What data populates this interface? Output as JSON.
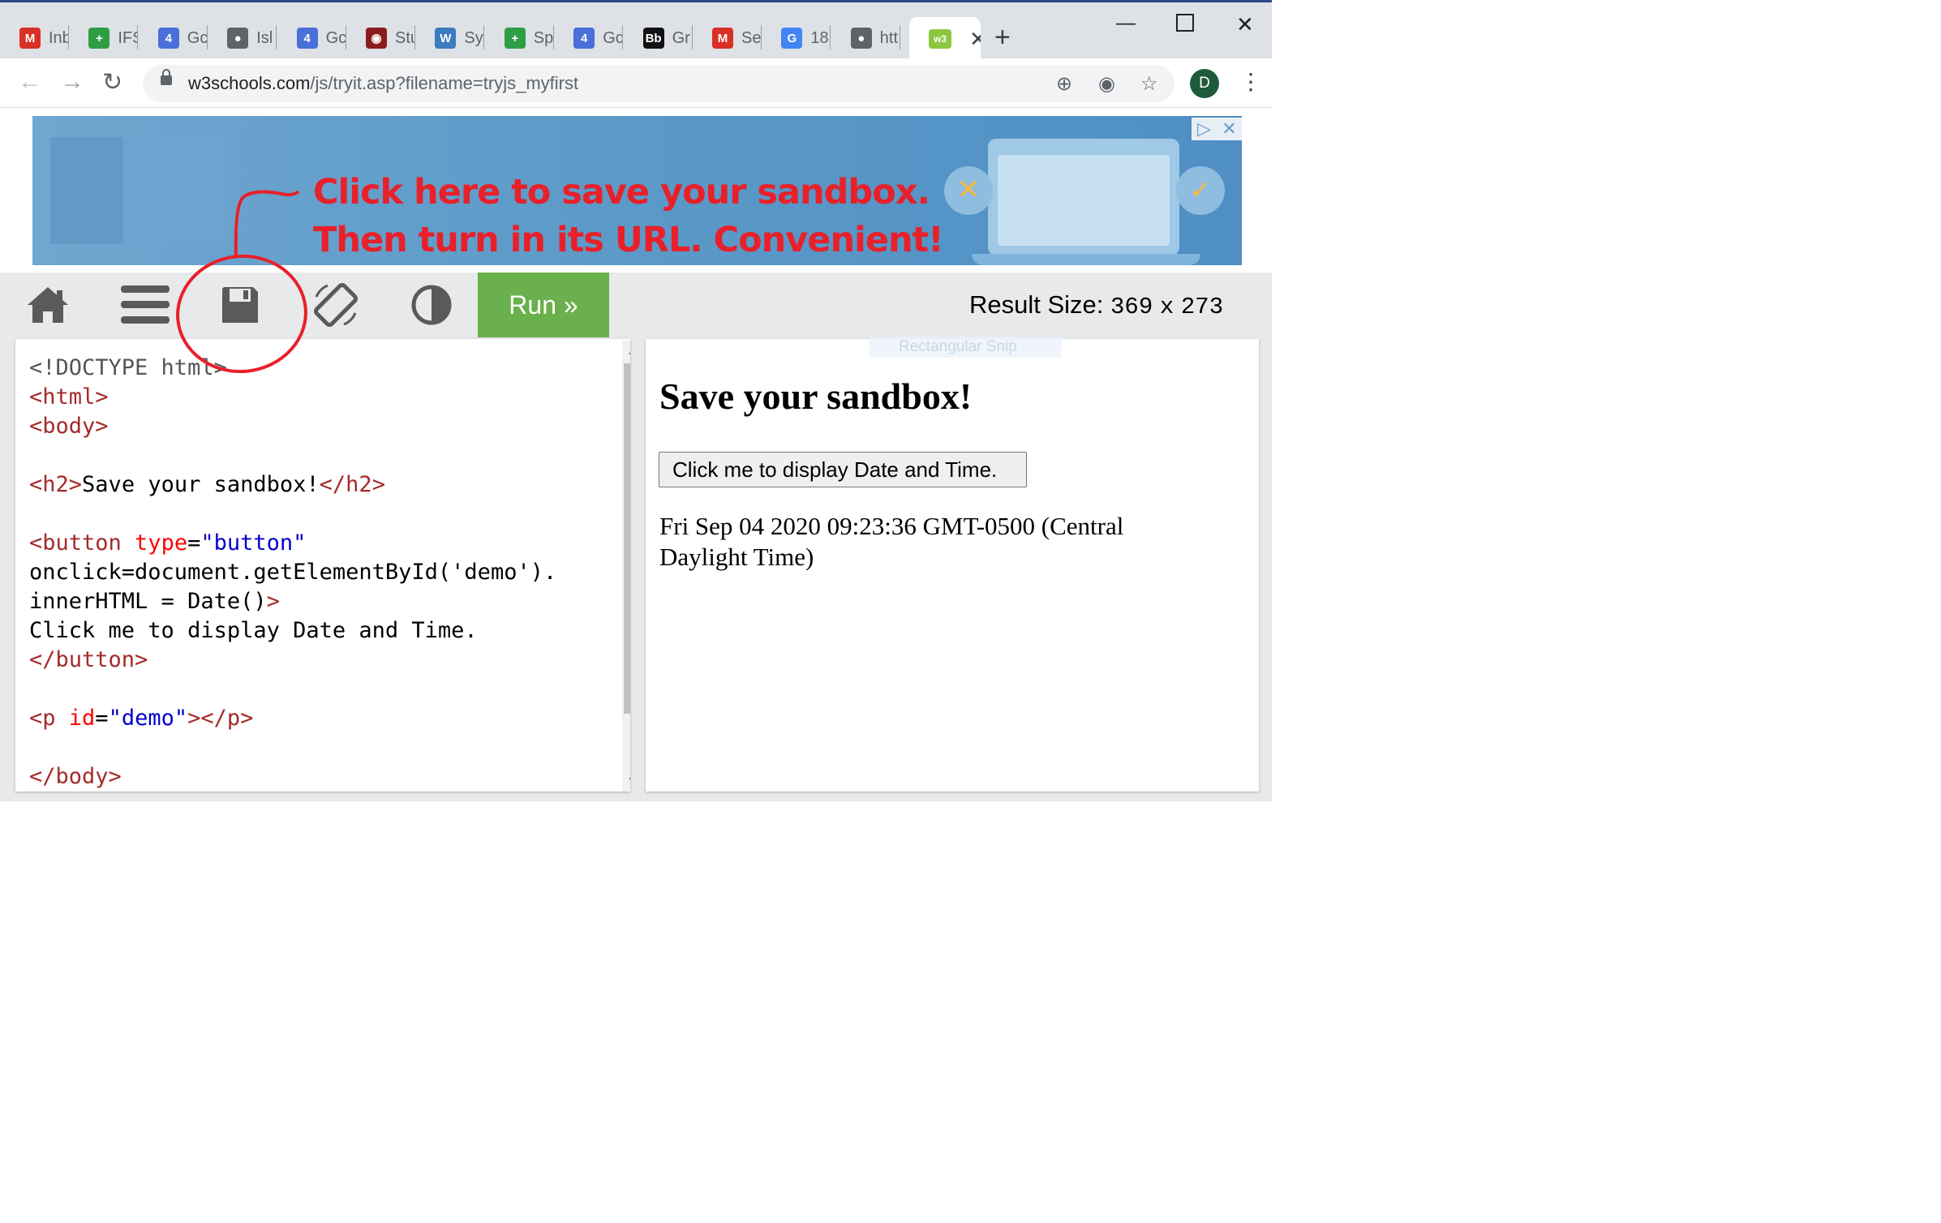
{
  "browser": {
    "tabs": [
      {
        "title": "Inb",
        "icon": "gmail-icon",
        "color": "#d93025",
        "glyph": "M"
      },
      {
        "title": "IFS",
        "icon": "plus-green-icon",
        "color": "#2e9e45",
        "glyph": "+"
      },
      {
        "title": "Gc",
        "icon": "calendar-icon",
        "color": "#4a6fd8",
        "glyph": "4"
      },
      {
        "title": "Isl",
        "icon": "globe-icon",
        "color": "#5f6368",
        "glyph": "●"
      },
      {
        "title": "Gc",
        "icon": "calendar-icon",
        "color": "#4a6fd8",
        "glyph": "4"
      },
      {
        "title": "Stu",
        "icon": "helmet-icon",
        "color": "#8a1c1c",
        "glyph": "◉"
      },
      {
        "title": "Sy",
        "icon": "wordpress-icon",
        "color": "#3b7bbf",
        "glyph": "W"
      },
      {
        "title": "Sp",
        "icon": "plus-green-icon",
        "color": "#2e9e45",
        "glyph": "+"
      },
      {
        "title": "Gc",
        "icon": "calendar-icon",
        "color": "#4a6fd8",
        "glyph": "4"
      },
      {
        "title": "Gr",
        "icon": "blackboard-icon",
        "color": "#111111",
        "glyph": "Bb"
      },
      {
        "title": "Se",
        "icon": "gmail-icon",
        "color": "#d93025",
        "glyph": "M"
      },
      {
        "title": "18",
        "icon": "google-icon",
        "color": "#4285f4",
        "glyph": "G"
      },
      {
        "title": "htt",
        "icon": "globe-icon",
        "color": "#5f6368",
        "glyph": "●"
      }
    ],
    "active_tab": {
      "icon": "w3schools-icon",
      "color": "#8cc63f",
      "glyph": "w3"
    },
    "url_host": "w3schools.com",
    "url_path": "/js/tryit.asp?filename=tryjs_myfirst",
    "avatar_letter": "D"
  },
  "annotation": {
    "line1": "Click here to save your sandbox.",
    "line2": "Then turn in its URL. Convenient!",
    "color": "#e8202a"
  },
  "w3toolbar": {
    "run_label": "Run »",
    "result_size_label": "Result Size:",
    "result_width": "369",
    "result_x": "x",
    "result_height": "273",
    "run_color": "#6ab04c"
  },
  "editor": {
    "lines": [
      "<!DOCTYPE html>",
      "<html>",
      "<body>",
      "",
      "<h2>Save your sandbox!</h2>",
      "",
      "<button type=\"button\"",
      "onclick=\"document.getElementById('demo').",
      "innerHTML = Date()\">",
      "Click me to display Date and Time.",
      "</button>",
      "",
      "<p id=\"demo\"></p>",
      "",
      "</body>"
    ]
  },
  "result": {
    "heading": "Save your sandbox!",
    "button_label": "Click me to display Date and Time.",
    "demo_text": "Fri Sep 04 2020 09:23:36 GMT-0500 (Central Daylight Time)"
  },
  "overlay": {
    "snip_label": "Rectangular Snip"
  }
}
